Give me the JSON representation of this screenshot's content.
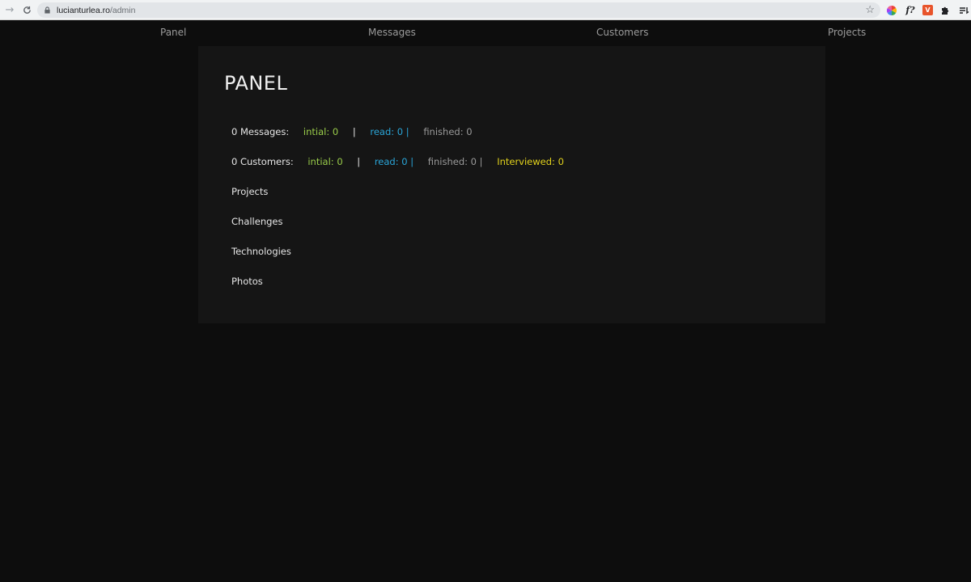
{
  "browser": {
    "url_host": "lucianturlea.ro",
    "url_path": "/admin",
    "icons": [
      "back-icon",
      "reload-icon",
      "lock-icon",
      "star-icon",
      "color-wheel-extension-icon",
      "font-extension-icon",
      "vpn-extension-icon",
      "puzzle-extensions-icon",
      "reading-list-icon"
    ],
    "vpn_label": "V"
  },
  "nav": {
    "items": [
      {
        "label": "Panel"
      },
      {
        "label": "Messages"
      },
      {
        "label": "Customers"
      },
      {
        "label": "Projects"
      }
    ]
  },
  "panel": {
    "title": "PANEL",
    "messages": {
      "label": "0 Messages:",
      "initial": "intial: 0",
      "sep1": "|",
      "read": "read: 0 |",
      "finished": "finished: 0"
    },
    "customers": {
      "label": "0 Customers:",
      "initial": "intial: 0",
      "sep1": "|",
      "read": "read: 0 |",
      "finished": "finished: 0 |",
      "interviewed": "Interviewed: 0"
    },
    "links": [
      {
        "label": "Projects"
      },
      {
        "label": "Challenges"
      },
      {
        "label": "Technologies"
      },
      {
        "label": "Photos"
      }
    ]
  },
  "colors": {
    "background": "#0d0d0d",
    "card": "#151515",
    "initial": "#9acd4a",
    "read": "#2aa6d9",
    "finished": "#9a9a9a",
    "interviewed": "#e2d21c"
  }
}
